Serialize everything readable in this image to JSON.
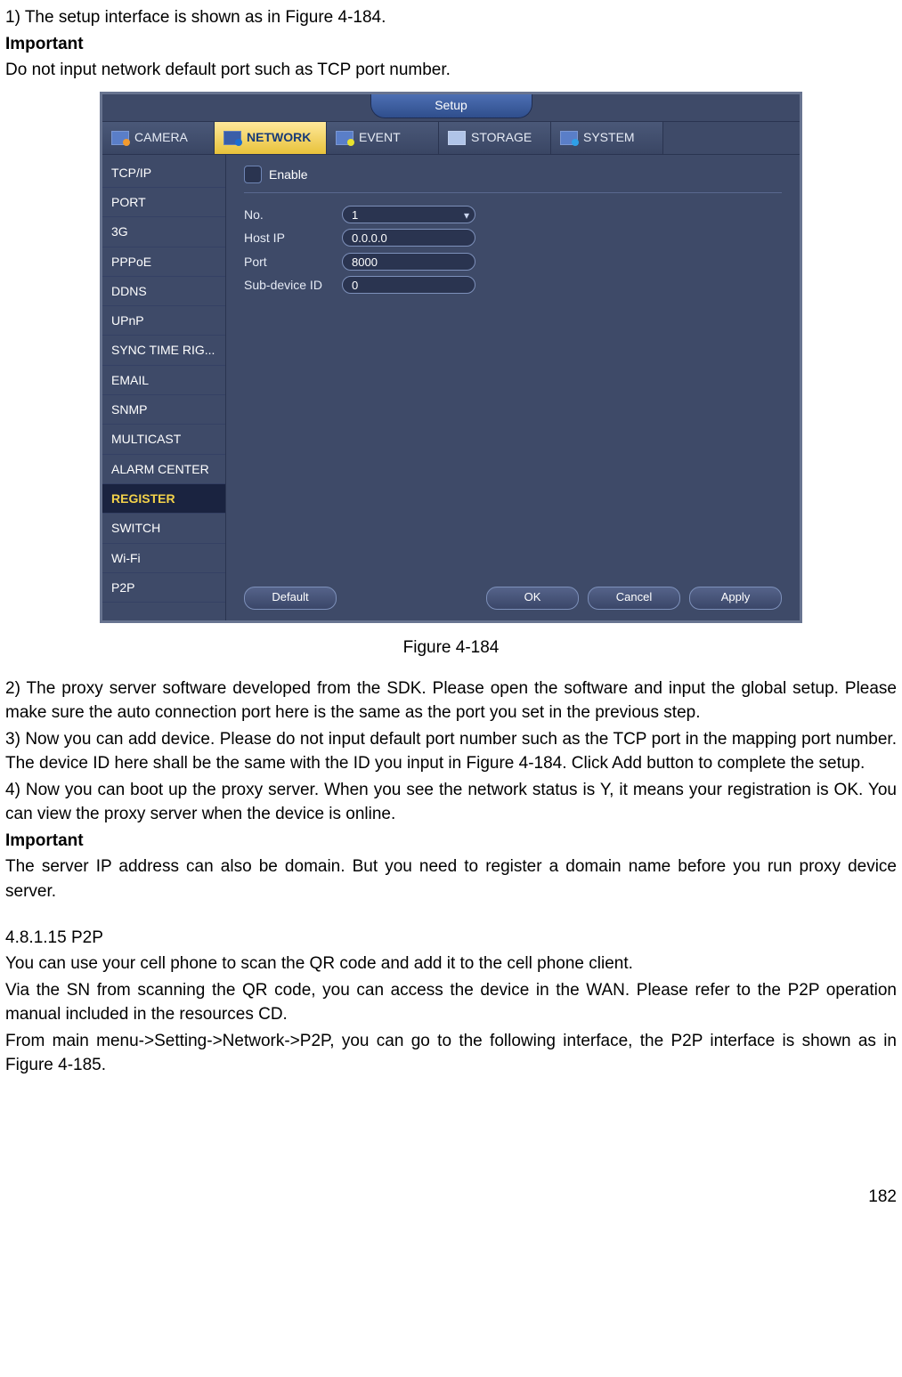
{
  "intro": {
    "line1": "1) The setup interface is shown as in Figure 4-184.",
    "important_label": "Important",
    "important_text": "Do not input network default port such as TCP port number."
  },
  "screenshot": {
    "setup_title": "Setup",
    "tabs": {
      "camera": "CAMERA",
      "network": "NETWORK",
      "event": "EVENT",
      "storage": "STORAGE",
      "system": "SYSTEM"
    },
    "side_items": [
      "TCP/IP",
      "PORT",
      "3G",
      "PPPoE",
      "DDNS",
      "UPnP",
      "SYNC TIME RIG...",
      "EMAIL",
      "SNMP",
      "MULTICAST",
      "ALARM CENTER",
      "REGISTER",
      "SWITCH",
      "Wi-Fi",
      "P2P"
    ],
    "selected_index": 11,
    "form": {
      "enable_label": "Enable",
      "fields": {
        "no_label": "No.",
        "no_value": "1",
        "host_ip_label": "Host IP",
        "host_ip_value": "0.0.0.0",
        "port_label": "Port",
        "port_value": "8000",
        "subdev_label": "Sub-device ID",
        "subdev_value": "0"
      },
      "buttons": {
        "default": "Default",
        "ok": "OK",
        "cancel": "Cancel",
        "apply": "Apply"
      }
    }
  },
  "figure_caption": "Figure 4-184",
  "body": {
    "p2": "2) The proxy server software developed from the SDK. Please open the software and input the global setup. Please make sure the auto connection port here is the same as the port you set in the previous step.",
    "p3": "3) Now you can add device. Please do not input default port number such as the TCP port in the mapping port number. The device ID here shall be the same with the ID you input in Figure 4-184. Click Add button to complete the setup.",
    "p4": "4) Now you can boot up the proxy server. When you see the network status is Y, it means your registration is OK. You can view the proxy server when the device is online.",
    "important_label2": "Important",
    "important_text2": "The server IP address can also be domain. But you need to register a domain name before you run proxy device server.",
    "sec_heading": "4.8.1.15  P2P",
    "p5": "You can use your cell phone to scan the QR code and add it to the cell phone client.",
    "p6": "Via the SN from scanning the QR code, you can access the device in the WAN. Please refer to the P2P operation manual included in the resources CD.",
    "p7": "From main menu->Setting->Network->P2P, you can go to the following interface, the P2P interface is shown as in Figure 4-185."
  },
  "page_number": "182"
}
